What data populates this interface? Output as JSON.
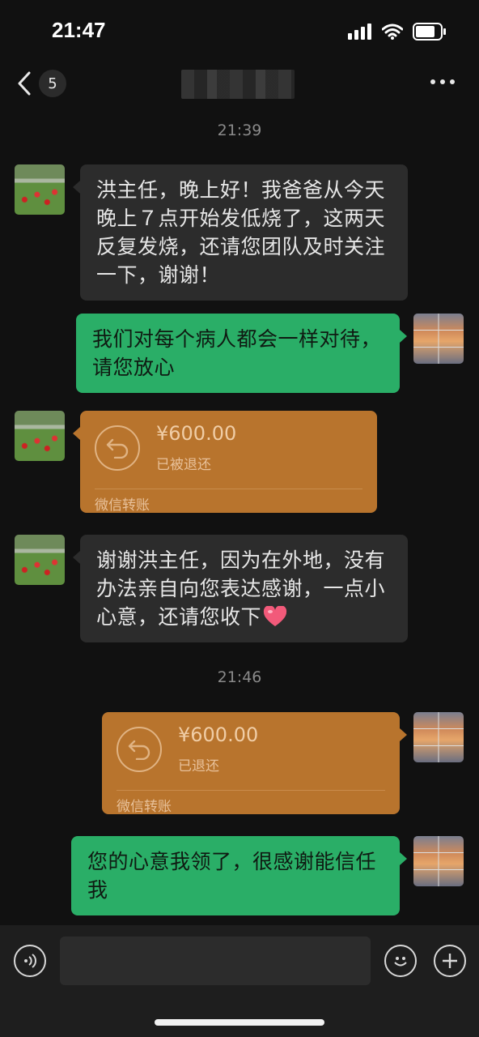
{
  "status_bar": {
    "time": "21:47",
    "icons": [
      "signal-icon",
      "wifi-icon",
      "battery-icon"
    ]
  },
  "nav": {
    "back_icon": "chevron-left-icon",
    "unread_count": "5",
    "title": "",
    "more_icon": "more-dots-icon"
  },
  "messages": [
    {
      "kind": "timestamp",
      "text": "21:39"
    },
    {
      "kind": "text",
      "side": "in",
      "text": "洪主任，晚上好！我爸爸从今天晚上７点开始发低烧了，这两天反复发烧，还请您团队及时关注一下，谢谢！"
    },
    {
      "kind": "text",
      "side": "out",
      "text": "我们对每个病人都会一样对待，请您放心"
    },
    {
      "kind": "transfer",
      "side": "in",
      "amount": "¥600.00",
      "status": "已被退还",
      "label": "微信转账",
      "icon": "return-arrow-icon"
    },
    {
      "kind": "text",
      "side": "in",
      "text": "谢谢洪主任，因为在外地，没有办法亲自向您表达感谢，一点小心意，还请您收下",
      "emoji": "heart-emoji"
    },
    {
      "kind": "timestamp",
      "text": "21:46"
    },
    {
      "kind": "transfer",
      "side": "out",
      "amount": "¥600.00",
      "status": "已退还",
      "label": "微信转账",
      "icon": "return-arrow-icon"
    },
    {
      "kind": "text",
      "side": "out",
      "text": "您的心意我领了，很感谢能信任我"
    }
  ],
  "input_bar": {
    "voice_icon": "voice-icon",
    "placeholder": "",
    "emoji_icon": "emoji-icon",
    "plus_icon": "plus-icon"
  },
  "colors": {
    "background": "#111111",
    "incoming_bubble": "#2c2c2c",
    "outgoing_bubble": "#2aae67",
    "transfer_bubble": "#b8742d"
  }
}
